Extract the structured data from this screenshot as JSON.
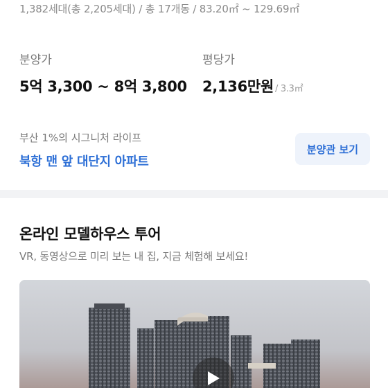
{
  "summary": "1,382세대(총 2,205세대) / 총 17개동 / 83.20㎡ ~ 129.69㎡",
  "price": {
    "sale_label": "분양가",
    "sale_value": "5억 3,300 ~ 8억 3,800",
    "per_pyeong_label": "평당가",
    "per_pyeong_value": "2,136만원",
    "per_pyeong_unit": "/ 3.3㎡"
  },
  "promo": {
    "subtitle": "부산 1%의 시그니처 라이프",
    "headline": "북항 맨 앞 대단지 아파트",
    "button_label": "분양관 보기"
  },
  "tour": {
    "title": "온라인 모델하우스 투어",
    "subtitle": "VR, 동영상으로 미리 보는 내 집, 지금 체험해 보세요!",
    "play_icon": "play-icon"
  },
  "colors": {
    "accent": "#2d6fd6",
    "button_bg": "#eef3fb",
    "divider": "#f2f3f5"
  }
}
